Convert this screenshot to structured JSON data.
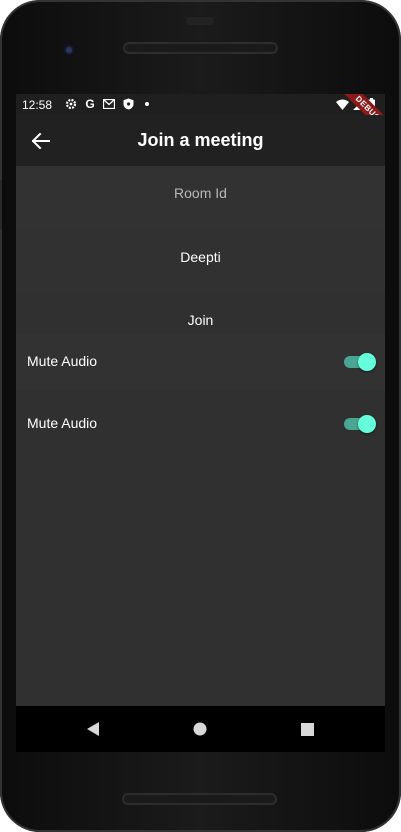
{
  "status_bar": {
    "time": "12:58",
    "icons": [
      "gear-icon",
      "google-icon",
      "gmail-icon",
      "shield-icon",
      "dot-icon"
    ],
    "right_icons": [
      "wifi-icon",
      "signal-icon",
      "battery-icon"
    ]
  },
  "debug_banner": "DEBUG",
  "app_bar": {
    "title": "Join a meeting",
    "back_icon": "arrow-left-icon"
  },
  "form": {
    "room_id_placeholder": "Room Id",
    "name_value": "Deepti",
    "join_label": "Join"
  },
  "toggles": [
    {
      "label": "Mute Audio",
      "on": true
    },
    {
      "label": "Mute Audio",
      "on": true
    }
  ],
  "colors": {
    "accent": "#64ffda",
    "track_on": "#4aa693",
    "app_bar": "#212121",
    "background": "#303030"
  },
  "nav": [
    "back-triangle-icon",
    "home-circle-icon",
    "recents-square-icon"
  ]
}
